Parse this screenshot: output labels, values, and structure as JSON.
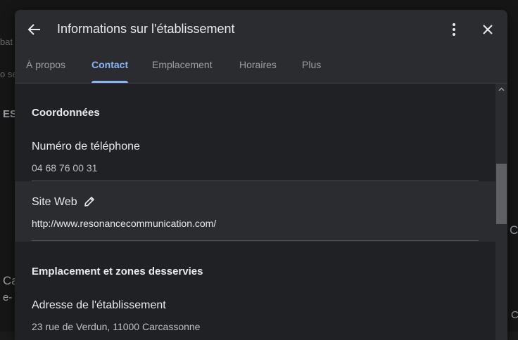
{
  "background": {
    "fragments": [
      "bat",
      "o se",
      "ES",
      "Ca",
      "e-",
      "CC",
      "Co"
    ]
  },
  "dialog": {
    "title": "Informations sur l'établissement",
    "icons": {
      "back": "arrow-back-icon",
      "more": "more-vert-icon",
      "close": "close-icon",
      "edit": "pencil-icon",
      "scroll_up": "chevron-up-icon"
    }
  },
  "tabs": [
    {
      "label": "À propos",
      "active": false
    },
    {
      "label": "Contact",
      "active": true
    },
    {
      "label": "Emplacement",
      "active": false
    },
    {
      "label": "Horaires",
      "active": false
    },
    {
      "label": "Plus",
      "active": false
    }
  ],
  "contact": {
    "section_title": "Coordonnées",
    "phone_label": "Numéro de téléphone",
    "phone_value": "04 68 76 00 31",
    "website_label": "Site Web",
    "website_value": "http://www.resonancecommunication.com/"
  },
  "location": {
    "section_title": "Emplacement et zones desservies",
    "address_label": "Adresse de l'établissement",
    "address_value": "23 rue de Verdun, 11000 Carcassonne"
  },
  "colors": {
    "accent": "#8ab4f8",
    "dialog_bg": "#2b2c2f",
    "content_bg": "#202124",
    "text_primary": "#e8eaed",
    "text_secondary": "#bdc1c6"
  }
}
